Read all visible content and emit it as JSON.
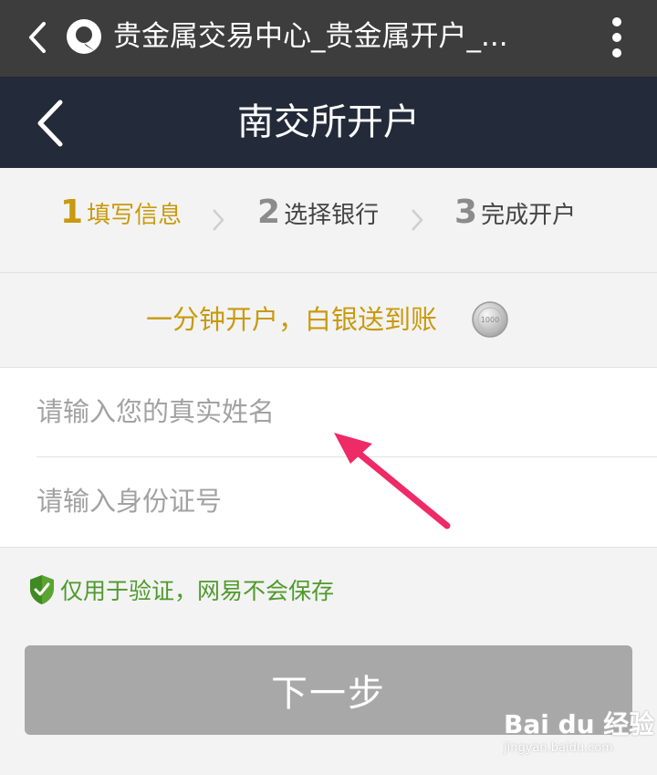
{
  "browser": {
    "title": "贵金属交易中心_贵金属开户_..."
  },
  "header": {
    "title": "南交所开户"
  },
  "steps": [
    {
      "num": "1",
      "label": "填写信息",
      "state": "active"
    },
    {
      "num": "2",
      "label": "选择银行",
      "state": "inactive"
    },
    {
      "num": "3",
      "label": "完成开户",
      "state": "inactive"
    }
  ],
  "promo": {
    "text": "一分钟开户，白银送到账",
    "coin_label": "1000"
  },
  "form": {
    "name_placeholder": "请输入您的真实姓名",
    "id_placeholder": "请输入身份证号"
  },
  "notice": {
    "text": "仅用于验证，网易不会保存"
  },
  "next_button": {
    "label": "下一步"
  },
  "watermark": {
    "brand": "Bai du 经验",
    "url": "jingyan.baidu.com"
  },
  "colors": {
    "accent": "#c99a0e",
    "header_bg": "#232a39",
    "browser_bg": "#3d3d3d",
    "notice_green": "#4f9a2c",
    "arrow_pink": "#ee2a67",
    "button_disabled": "#a8a8a8"
  },
  "icons": {
    "browser_back": "chevron-left-icon",
    "browser_logo": "browser-logo-icon",
    "browser_menu": "more-vertical-icon",
    "nav_back": "chevron-left-icon",
    "step_separator": "chevron-right-icon",
    "coin": "silver-coin-icon",
    "shield": "shield-check-icon",
    "annotation": "arrow-annotation"
  }
}
